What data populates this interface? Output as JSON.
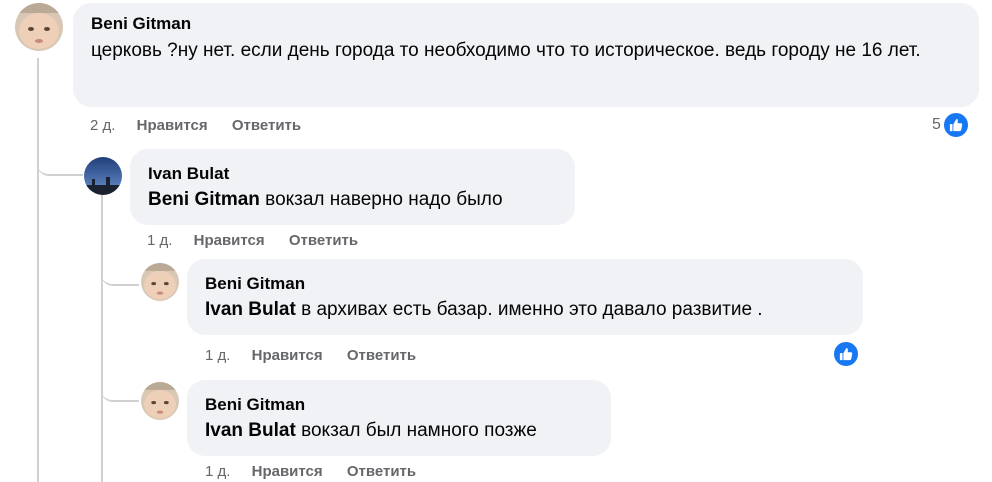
{
  "comments": [
    {
      "author": "Beni Gitman",
      "text": "церковь ?ну нет. если день города то необходимо что то историческое. ведь городу не 16 лет.",
      "time": "2 д.",
      "like": "Нравится",
      "reply": "Ответить",
      "reactions": "5",
      "reaction_icon": "like-icon"
    },
    {
      "author": "Ivan Bulat",
      "mention": "Beni Gitman",
      "text": " вокзал наверно надо было",
      "time": "1 д.",
      "like": "Нравится",
      "reply": "Ответить"
    },
    {
      "author": "Beni Gitman",
      "mention": "Ivan Bulat",
      "text": " в архивах есть базар. именно это давало развитие .",
      "time": "1 д.",
      "like": "Нравится",
      "reply": "Ответить",
      "reaction_icon": "like-icon"
    },
    {
      "author": "Beni Gitman",
      "mention": "Ivan Bulat",
      "text": " вокзал был намного позже",
      "time": "1 д.",
      "like": "Нравится",
      "reply": "Ответить"
    }
  ],
  "colors": {
    "bubble": "#f0f2f5",
    "meta": "#65676b",
    "like_blue": "#1877f2",
    "thread": "#ced0d4"
  }
}
